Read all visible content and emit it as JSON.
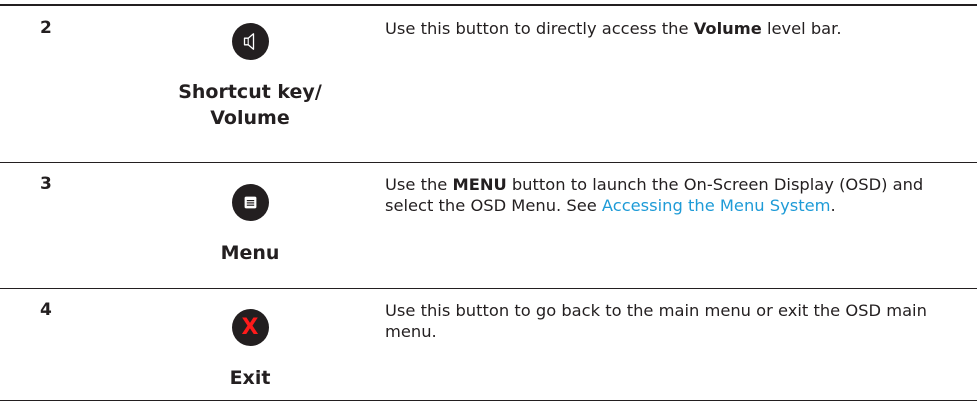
{
  "colors": {
    "text": "#231f20",
    "link": "#1e9bd7",
    "exit_x": "#ff1a1a",
    "rule": "#231f20"
  },
  "rows": [
    {
      "number": "2",
      "icon": "speaker-volume-icon",
      "label": "Shortcut key/ Volume",
      "label_lines": [
        "Shortcut key/",
        "Volume"
      ],
      "desc": {
        "before": "Use this button to directly access the ",
        "bold": "Volume",
        "after": " level bar."
      }
    },
    {
      "number": "3",
      "icon": "menu-icon",
      "label": "Menu",
      "desc": {
        "before": "Use the ",
        "bold": "MENU",
        "middle": " button to launch the On-Screen Display (OSD) and select the OSD Menu. See ",
        "link": "Accessing the Menu System",
        "after": "."
      }
    },
    {
      "number": "4",
      "icon": "exit-x-icon",
      "icon_text": "X",
      "label": "Exit",
      "desc": {
        "text": "Use this button to go back to the main menu or exit the OSD main menu."
      }
    }
  ]
}
